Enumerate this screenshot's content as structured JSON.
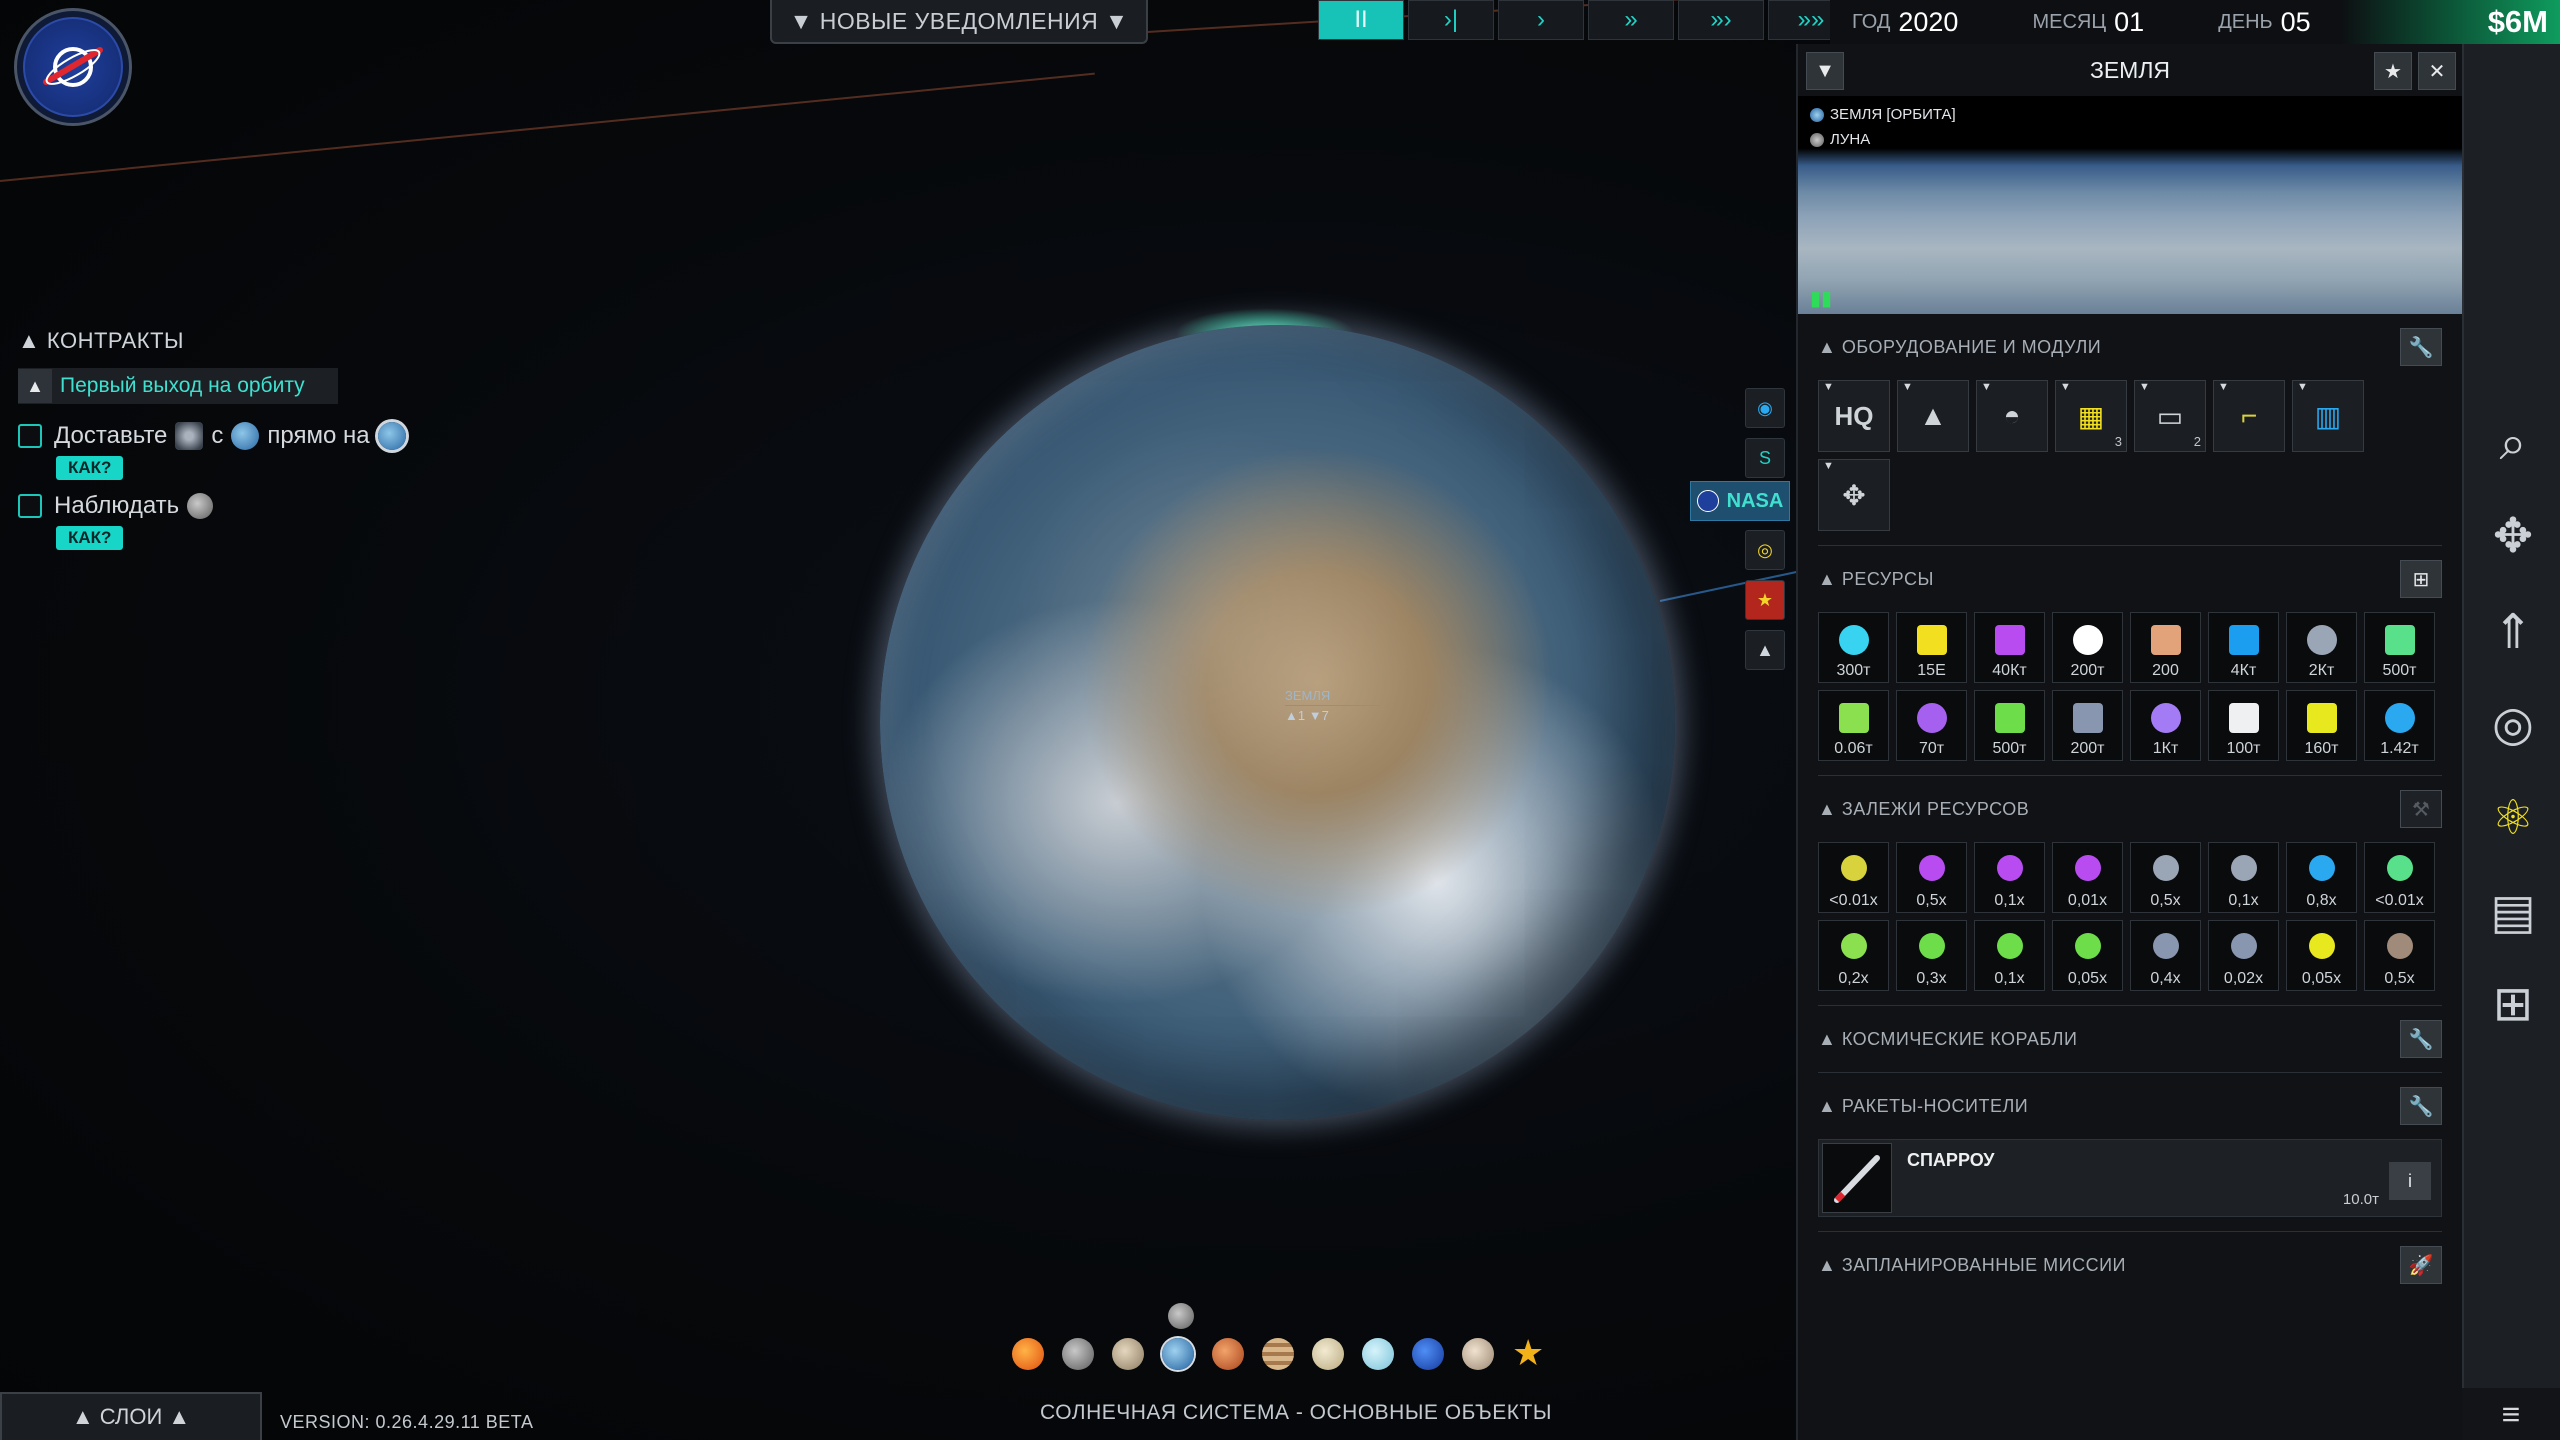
{
  "header": {
    "notifications_label": "▼ НОВЫЕ УВЕДОМЛЕНИЯ ▼",
    "time_controls": [
      "II",
      "›|",
      "›",
      "»",
      "»›",
      "»»"
    ],
    "date": {
      "year_label": "ГОД",
      "year": "2020",
      "month_label": "МЕСЯЦ",
      "month": "01",
      "day_label": "ДЕНЬ",
      "day": "05"
    },
    "money": "$6M"
  },
  "contracts": {
    "title": "▲ КОНТРАКТЫ",
    "contract_name": "Первый выход на орбиту",
    "tasks": [
      {
        "text_a": "Доставьте",
        "text_b": "с",
        "text_c": "прямо на",
        "how": "КАК?"
      },
      {
        "text_a": "Наблюдать",
        "how": "КАК?"
      }
    ]
  },
  "map": {
    "planet_label": "ЗЕМЛЯ",
    "planet_counts": "▲1  ▼7",
    "nasa_label": "NASA",
    "strip_planets": [
      "sun",
      "mercury",
      "venus",
      "earth",
      "mars",
      "jupiter",
      "saturn",
      "uranus",
      "neptune",
      "pluto",
      "favorites-star"
    ],
    "system_name": "СОЛНЕЧНАЯ СИСТЕМА - ОСНОВНЫЕ ОБЪЕКТЫ"
  },
  "footer": {
    "layers_label": "▲ СЛОИ ▲",
    "version": "VERSION: 0.26.4.29.11 BETA"
  },
  "panel": {
    "title": "ЗЕМЛЯ",
    "links": [
      "ЗЕМЛЯ [ОРБИТА]",
      "ЛУНА"
    ],
    "sections": {
      "equipment": "ОБОРУДОВАНИЕ И МОДУЛИ",
      "resources": "РЕСУРСЫ",
      "deposits": "ЗАЛЕЖИ РЕСУРСОВ",
      "spacecraft": "КОСМИЧЕСКИЕ КОРАБЛИ",
      "launchers": "РАКЕТЫ-НОСИТЕЛИ",
      "missions": "ЗАПЛАНИРОВАННЫЕ МИССИИ"
    },
    "equipment": [
      {
        "icon": "HQ",
        "count": ""
      },
      {
        "icon": "launch-tower",
        "count": ""
      },
      {
        "icon": "observatory",
        "count": ""
      },
      {
        "icon": "solar-panel",
        "count": "3"
      },
      {
        "icon": "factory",
        "count": "2"
      },
      {
        "icon": "robot-arm",
        "count": ""
      },
      {
        "icon": "refinery",
        "count": ""
      },
      {
        "icon": "satellite",
        "count": ""
      }
    ],
    "resources": [
      {
        "icon": "chip",
        "value": "300т",
        "color": "#38d3f0"
      },
      {
        "icon": "energy",
        "value": "15Е",
        "color": "#f2e020"
      },
      {
        "icon": "fuel-drop",
        "value": "40Кт",
        "color": "#b84cf0"
      },
      {
        "icon": "medkit",
        "value": "200т",
        "color": "#ffffff"
      },
      {
        "icon": "person",
        "value": "200",
        "color": "#e3a37a"
      },
      {
        "icon": "cycle",
        "value": "4Кт",
        "color": "#1b9ef0"
      },
      {
        "icon": "panel",
        "value": "2Кт",
        "color": "#9aa5b6"
      },
      {
        "icon": "cluster",
        "value": "500т",
        "color": "#58e08a"
      },
      {
        "icon": "molecule",
        "value": "0.06т",
        "color": "#8be04f"
      },
      {
        "icon": "network",
        "value": "70т",
        "color": "#a660f0"
      },
      {
        "icon": "gem-green",
        "value": "500т",
        "color": "#6ddd4a"
      },
      {
        "icon": "rock",
        "value": "200т",
        "color": "#8896b0"
      },
      {
        "icon": "gem-violet",
        "value": "1Кт",
        "color": "#a37bf5"
      },
      {
        "icon": "food",
        "value": "100т",
        "color": "#eef0f2"
      },
      {
        "icon": "radiation",
        "value": "160т",
        "color": "#e8e81e"
      },
      {
        "icon": "water",
        "value": "1.42т",
        "color": "#2aa9f0"
      }
    ],
    "deposits": [
      {
        "value": "<0.01x",
        "color": "#d8d33c"
      },
      {
        "value": "0,5x",
        "color": "#b84cf0"
      },
      {
        "value": "0,1x",
        "color": "#b84cf0"
      },
      {
        "value": "0,01x",
        "color": "#b84cf0"
      },
      {
        "value": "0,5x",
        "color": "#9aa5b6"
      },
      {
        "value": "0,1x",
        "color": "#9aa5b6"
      },
      {
        "value": "0,8x",
        "color": "#2aa9f0"
      },
      {
        "value": "<0.01x",
        "color": "#58e08a"
      },
      {
        "value": "0,2x",
        "color": "#8be04f"
      },
      {
        "value": "0,3x",
        "color": "#6ddd4a"
      },
      {
        "value": "0,1x",
        "color": "#6ddd4a"
      },
      {
        "value": "0,05x",
        "color": "#6ddd4a"
      },
      {
        "value": "0,4x",
        "color": "#8896b0"
      },
      {
        "value": "0,02x",
        "color": "#8896b0"
      },
      {
        "value": "0,05x",
        "color": "#e8e81e"
      },
      {
        "value": "0,5x",
        "color": "#a08a7a"
      }
    ],
    "launcher": {
      "name": "СПАРРОУ",
      "mass": "10.0т",
      "info": "i"
    }
  }
}
